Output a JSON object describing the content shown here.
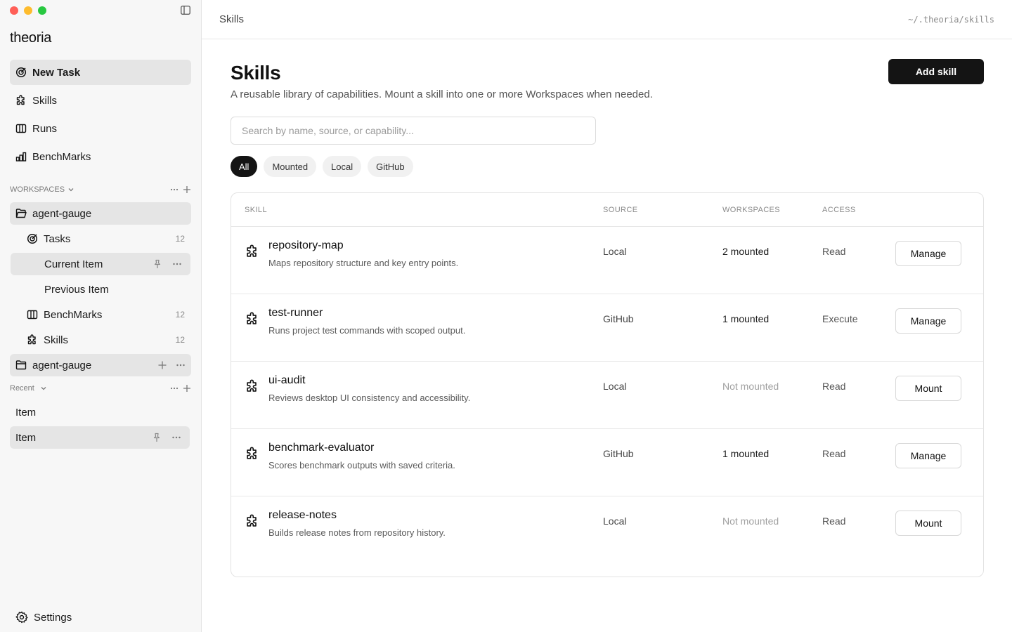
{
  "app": {
    "brand": "theoria"
  },
  "nav": {
    "new_task": "New Task",
    "skills": "Skills",
    "runs": "Runs",
    "benchmarks": "BenchMarks"
  },
  "workspaces": {
    "header": "WORKSPACES",
    "items": [
      {
        "name": "agent-gauge",
        "children": {
          "tasks": {
            "label": "Tasks",
            "count": "12"
          },
          "current_item": "Current Item",
          "previous_item": "Previous Item",
          "benchmarks": {
            "label": "BenchMarks",
            "count": "12"
          },
          "skills": {
            "label": "Skills",
            "count": "12"
          }
        }
      },
      {
        "name": "agent-gauge"
      }
    ]
  },
  "recent": {
    "header": "Recent",
    "items": [
      "Item",
      "Item"
    ]
  },
  "settings": "Settings",
  "topbar": {
    "breadcrumb": "Skills",
    "path": "~/.theoria/skills"
  },
  "page": {
    "title": "Skills",
    "subtitle": "A reusable library of capabilities. Mount a skill into one or more Workspaces when needed.",
    "add_button": "Add skill",
    "search_placeholder": "Search by name, source, or capability...",
    "filters": [
      "All",
      "Mounted",
      "Local",
      "GitHub"
    ],
    "active_filter": "All"
  },
  "table": {
    "columns": [
      "SKILL",
      "SOURCE",
      "WORKSPACES",
      "ACCESS"
    ],
    "rows": [
      {
        "name": "repository-map",
        "desc": "Maps repository structure and key entry points.",
        "source": "Local",
        "workspaces": "2 mounted",
        "access": "Read",
        "action": "Manage",
        "mounted": true
      },
      {
        "name": "test-runner",
        "desc": "Runs project test commands with scoped output.",
        "source": "GitHub",
        "workspaces": "1 mounted",
        "access": "Execute",
        "action": "Manage",
        "mounted": true
      },
      {
        "name": "ui-audit",
        "desc": "Reviews desktop UI consistency and accessibility.",
        "source": "Local",
        "workspaces": "Not mounted",
        "access": "Read",
        "action": "Mount",
        "mounted": false
      },
      {
        "name": "benchmark-evaluator",
        "desc": "Scores benchmark outputs with saved criteria.",
        "source": "GitHub",
        "workspaces": "1 mounted",
        "access": "Read",
        "action": "Manage",
        "mounted": true
      },
      {
        "name": "release-notes",
        "desc": "Builds release notes from repository history.",
        "source": "Local",
        "workspaces": "Not mounted",
        "access": "Read",
        "action": "Mount",
        "mounted": false
      }
    ]
  },
  "colors": {
    "accent": "#141414",
    "active_bg": "#e5e5e5",
    "sidebar_bg": "#f7f7f7"
  }
}
